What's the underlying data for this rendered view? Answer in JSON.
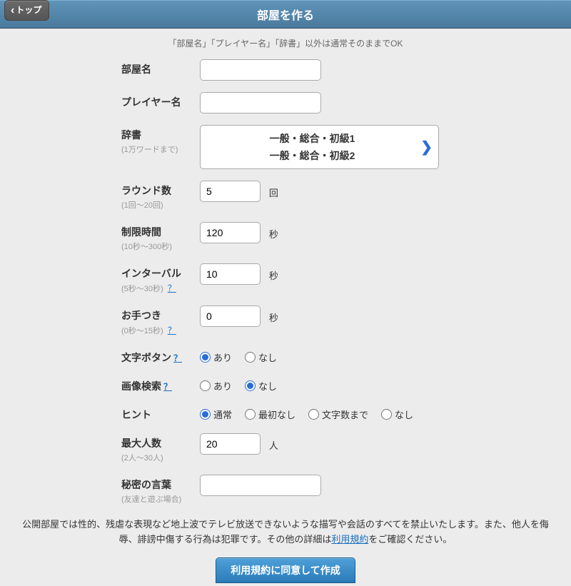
{
  "header": {
    "title": "部屋を作る",
    "top_button": "トップ"
  },
  "hint_text": "「部屋名」「プレイヤー名」「辞書」以外は通常そのままでOK",
  "fields": {
    "room_name": {
      "label": "部屋名",
      "value": ""
    },
    "player_name": {
      "label": "プレイヤー名",
      "value": ""
    },
    "dictionary": {
      "label": "辞書",
      "sublabel": "(1万ワードまで)",
      "items": [
        "一般・総合・初級1",
        "一般・総合・初級2"
      ]
    },
    "rounds": {
      "label": "ラウンド数",
      "sublabel": "(1回〜20回)",
      "value": "5",
      "unit": "回"
    },
    "time_limit": {
      "label": "制限時間",
      "sublabel": "(10秒〜300秒)",
      "value": "120",
      "unit": "秒"
    },
    "interval": {
      "label": "インターバル",
      "sublabel": "(5秒〜30秒)",
      "value": "10",
      "unit": "秒",
      "help": "？"
    },
    "penalty": {
      "label": "お手つき",
      "sublabel": "(0秒〜15秒)",
      "value": "0",
      "unit": "秒",
      "help": "？"
    },
    "char_button": {
      "label": "文字ボタン",
      "help": "？",
      "options": [
        {
          "label": "あり",
          "value": "yes",
          "checked": true
        },
        {
          "label": "なし",
          "value": "no",
          "checked": false
        }
      ]
    },
    "image_search": {
      "label": "画像検索",
      "help": "？",
      "options": [
        {
          "label": "あり",
          "value": "yes",
          "checked": false
        },
        {
          "label": "なし",
          "value": "no",
          "checked": true
        }
      ]
    },
    "hint": {
      "label": "ヒント",
      "options": [
        {
          "label": "通常",
          "value": "normal",
          "checked": true
        },
        {
          "label": "最初なし",
          "value": "nofirst",
          "checked": false
        },
        {
          "label": "文字数まで",
          "value": "lenonly",
          "checked": false
        },
        {
          "label": "なし",
          "value": "none",
          "checked": false
        }
      ]
    },
    "max_players": {
      "label": "最大人数",
      "sublabel": "(2人〜30人)",
      "value": "20",
      "unit": "人"
    },
    "secret": {
      "label": "秘密の言葉",
      "sublabel": "(友達と遊ぶ場合)",
      "value": ""
    }
  },
  "notice": {
    "text_before": "公開部屋では性的、残虐な表現など地上波でテレビ放送できないような描写や会話のすべてを禁止いたします。また、他人を侮辱、誹謗中傷する行為は犯罪です。その他の詳細は",
    "link": "利用規約",
    "text_after": "をご確認ください。"
  },
  "submit": "利用規約に同意して作成"
}
